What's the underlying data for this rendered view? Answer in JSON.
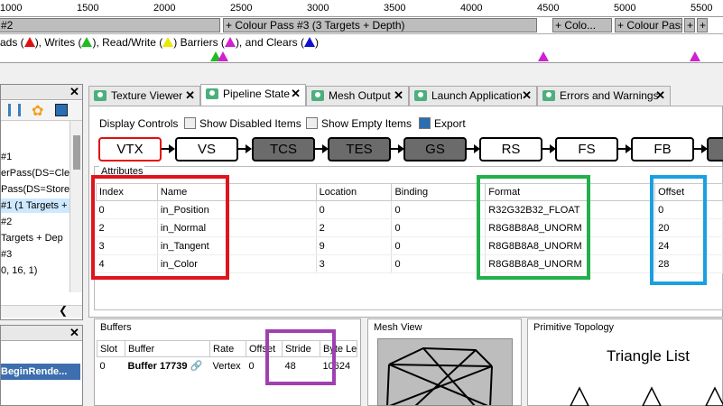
{
  "timeline": {
    "ruler_ticks": [
      "1000",
      "1500",
      "2000",
      "2500",
      "3000",
      "3500",
      "4000",
      "4500",
      "5000",
      "5500"
    ],
    "passes": [
      {
        "label": "#2"
      },
      {
        "label": "+ Colour Pass #3 (3 Targets + Depth)"
      },
      {
        "label": "+ Colo..."
      },
      {
        "label": "+ Colour Pass..."
      },
      {
        "label": "+"
      },
      {
        "label": "+"
      }
    ],
    "legend": {
      "reads": "ads (",
      "writes": "), Writes (",
      "readwrite": "), Read/Write (",
      "barriers": ") Barriers (",
      "clears": "), and Clears (",
      "end": ")"
    },
    "colors": {
      "read": "#e01010",
      "write": "#22bb22",
      "readwrite": "#e8e800",
      "barrier": "#d020d0",
      "clear": "#1010d0"
    }
  },
  "left_panel": {
    "rows": [
      "#1",
      "erPass(DS=Clea",
      "Pass(DS=Store)",
      "#1 (1 Targets +",
      "#2",
      " Targets + Dep",
      "#3",
      "0, 16, 1)"
    ],
    "lower_row": "BeginRende..."
  },
  "tabs": [
    {
      "label": "Texture Viewer"
    },
    {
      "label": "Pipeline State"
    },
    {
      "label": "Mesh Output"
    },
    {
      "label": "Launch Application"
    },
    {
      "label": "Errors and Warnings"
    }
  ],
  "toolbar": {
    "display_controls": "Display Controls",
    "show_disabled": "Show Disabled Items",
    "show_empty": "Show Empty Items",
    "export": "Export"
  },
  "pipeline": {
    "stages": [
      "VTX",
      "VS",
      "TCS",
      "TES",
      "GS",
      "RS",
      "FS",
      "FB"
    ]
  },
  "attributes": {
    "title": "Attributes",
    "columns": [
      "Index",
      "Name",
      "Location",
      "Binding",
      "Format",
      "Offset"
    ],
    "rows": [
      {
        "index": "0",
        "name": "in_Position",
        "location": "0",
        "binding": "0",
        "format": "R32G32B32_FLOAT",
        "offset": "0"
      },
      {
        "index": "2",
        "name": "in_Normal",
        "location": "2",
        "binding": "0",
        "format": "R8G8B8A8_UNORM",
        "offset": "20"
      },
      {
        "index": "3",
        "name": "in_Tangent",
        "location": "9",
        "binding": "0",
        "format": "R8G8B8A8_UNORM",
        "offset": "24"
      },
      {
        "index": "4",
        "name": "in_Color",
        "location": "3",
        "binding": "0",
        "format": "R8G8B8A8_UNORM",
        "offset": "28"
      }
    ]
  },
  "buffers": {
    "title": "Buffers",
    "columns": [
      "Slot",
      "Buffer",
      "Rate",
      "Offset",
      "Stride",
      "Byte Le"
    ],
    "row": {
      "slot": "0",
      "buffer": "Buffer 17739",
      "rate": "Vertex",
      "offset": "0",
      "stride": "48",
      "byte_length": "10624"
    }
  },
  "mesh_view": {
    "title": "Mesh View"
  },
  "topology": {
    "title": "Primitive Topology",
    "value": "Triangle List"
  },
  "highlight_colors": {
    "red": "#e0141e",
    "green": "#22b04a",
    "blue": "#1aa0e0",
    "purple": "#a040b0"
  }
}
